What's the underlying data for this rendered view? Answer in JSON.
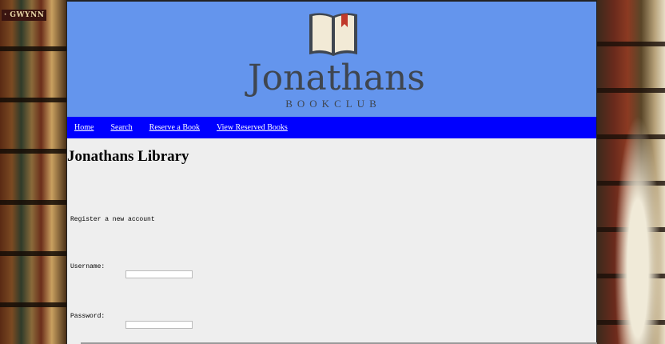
{
  "background": {
    "left_book_text": "· GWYNN"
  },
  "header": {
    "brand_name": "Jonathans",
    "brand_sub": "BOOKCLUB",
    "colors": {
      "header_bg": "#6495ed",
      "nav_bg": "#0000ff",
      "content_bg": "#eeeeee"
    }
  },
  "nav": {
    "items": [
      {
        "label": "Home"
      },
      {
        "label": "Search"
      },
      {
        "label": "Reserve a Book"
      },
      {
        "label": "View Reserved Books"
      }
    ]
  },
  "main": {
    "title": "Jonathans Library",
    "register_text": "Register a new account",
    "username_label": "Username:",
    "username_value": "",
    "password_label": "Password:",
    "password_value": ""
  },
  "icons": {
    "logo": "open-book-with-bookmark-icon"
  }
}
